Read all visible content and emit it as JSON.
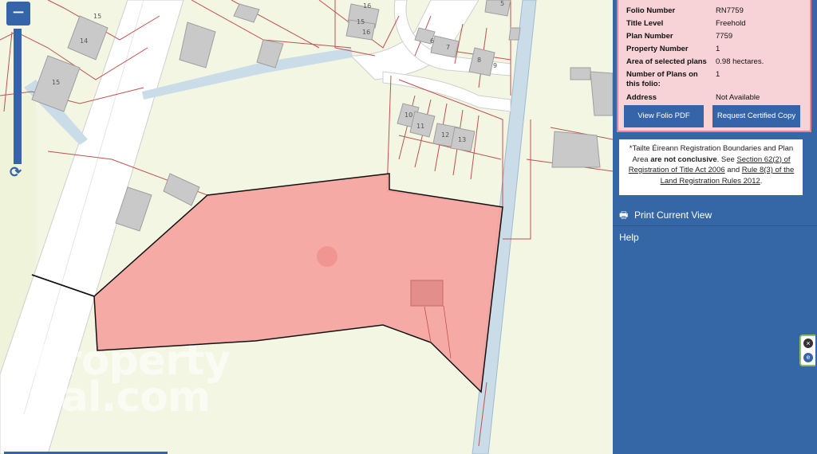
{
  "map": {
    "watermark_lines": [
      "Property",
      "Pal.com"
    ],
    "house_numbers": [
      "15",
      "14",
      "15",
      "16",
      "15",
      "16",
      "5",
      "6",
      "7",
      "8",
      "9",
      "10",
      "11",
      "12",
      "13"
    ],
    "colors": {
      "background": "#f4f6e4",
      "road": "#ffffff",
      "water": "#c9dce8",
      "parcel_fill": "#f5a3a0",
      "boundary": "#c0504d",
      "building": "#c9c9c9"
    }
  },
  "zoom": {
    "out_label": "−",
    "refresh_icon": "refresh-icon"
  },
  "panel": {
    "folio": [
      {
        "key": "Folio Number",
        "value": "RN7759"
      },
      {
        "key": "Title Level",
        "value": "Freehold"
      },
      {
        "key": "Plan Number",
        "value": "7759"
      },
      {
        "key": "Property Number",
        "value": "1"
      },
      {
        "key": "Area of selected plans",
        "value": "0.98 hectares."
      },
      {
        "key": "Number of Plans on this folio:",
        "value": "1"
      },
      {
        "key": "Address",
        "value": "Not Available"
      }
    ],
    "view_pdf": "View Folio PDF",
    "request_copy": "Request Certified Copy",
    "note": {
      "prefix": "*Tailte Éireann Registration Boundaries and Plan Area ",
      "bold": "are not conclusive",
      "mid": ". See ",
      "link1": "Section 62(2) of Registration of Title Act 2006",
      "and": " and ",
      "link2": "Rule 8(3) of the Land Registration Rules 2012",
      "end": "."
    },
    "print_label": "Print Current View",
    "help_label": "Help"
  }
}
